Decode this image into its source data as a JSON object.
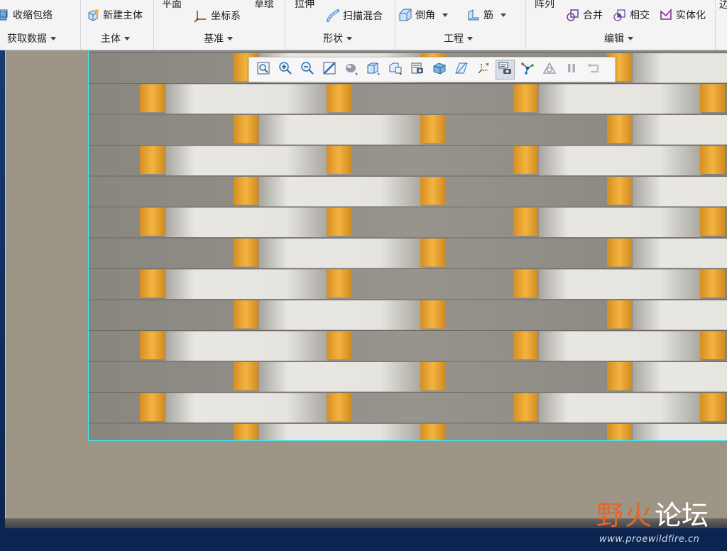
{
  "ribbon": {
    "groups": [
      {
        "label": "获取数据",
        "items": [
          {
            "label": "收缩包络",
            "icon": "shrinkwrap-icon"
          }
        ]
      },
      {
        "label": "主体",
        "items": [
          {
            "label": "新建主体",
            "icon": "new-body-icon"
          }
        ]
      },
      {
        "label": "基准",
        "items": [
          {
            "label": "平面",
            "icon": "plane-icon"
          },
          {
            "label": "坐标系",
            "icon": "coordinate-system-icon"
          },
          {
            "label": "草绘",
            "icon": "sketch-icon"
          }
        ]
      },
      {
        "label": "形状",
        "items": [
          {
            "label": "拉伸",
            "icon": "extrude-icon"
          },
          {
            "label": "扫描混合",
            "icon": "swept-blend-icon"
          }
        ]
      },
      {
        "label": "工程",
        "items": [
          {
            "label": "倒角",
            "icon": "chamfer-icon"
          },
          {
            "label": "筋",
            "icon": "rib-icon"
          }
        ]
      },
      {
        "label": "编辑",
        "items": [
          {
            "label": "阵列",
            "icon": "pattern-icon"
          },
          {
            "label": "合并",
            "icon": "merge-icon"
          },
          {
            "label": "相交",
            "icon": "intersect-icon"
          },
          {
            "label": "实体化",
            "icon": "solidify-icon"
          }
        ]
      }
    ],
    "cut_right_label": "边"
  },
  "view_toolbar": [
    {
      "name": "refit",
      "icon": "refit-icon"
    },
    {
      "name": "zoom-in",
      "icon": "zoom-in-icon"
    },
    {
      "name": "zoom-out",
      "icon": "zoom-out-icon"
    },
    {
      "name": "repaint",
      "icon": "repaint-icon"
    },
    {
      "name": "perspective",
      "icon": "perspective-icon"
    },
    {
      "name": "display-style",
      "icon": "shaded-display-icon"
    },
    {
      "name": "saved-orientations",
      "icon": "saved-orientations-icon"
    },
    {
      "name": "view-manager",
      "icon": "view-manager-icon"
    },
    {
      "name": "section",
      "icon": "section-icon"
    },
    {
      "name": "plane-display",
      "icon": "plane-display-icon"
    },
    {
      "name": "csys-display",
      "icon": "csys-display-icon"
    },
    {
      "name": "annotation-display",
      "icon": "annotation-display-icon",
      "active": true
    },
    {
      "name": "spin-center",
      "icon": "spin-center-icon"
    },
    {
      "name": "datum-display",
      "icon": "datum-display-icon"
    },
    {
      "name": "pause",
      "icon": "pause-icon"
    },
    {
      "name": "regenerate",
      "icon": "regenerate-icon"
    }
  ],
  "model": {
    "description_colors": {
      "strand_light": "#e9e7e3",
      "strand_dark": "#8a8780",
      "warp": "#e6a233",
      "frame": "#9d9585",
      "edge": "#3ee7ef"
    }
  },
  "watermark": {
    "chars": [
      "野",
      "火",
      "论坛"
    ],
    "url": "www.proewildfire.cn"
  }
}
